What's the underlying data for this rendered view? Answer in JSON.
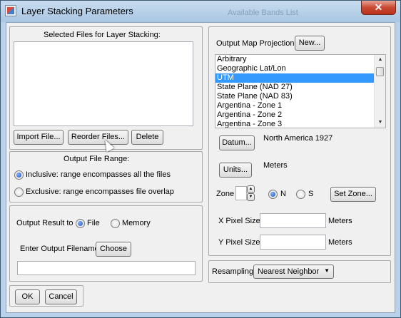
{
  "window": {
    "title": "Layer Stacking Parameters",
    "background_title": "Available Bands List",
    "close_glyph": "✕"
  },
  "files": {
    "heading": "Selected Files for Layer Stacking:",
    "import_label": "Import File...",
    "reorder_label": "Reorder Files...",
    "delete_label": "Delete"
  },
  "range": {
    "heading": "Output File Range:",
    "inclusive_label": "Inclusive: range encompasses all the files",
    "exclusive_label": "Exclusive: range encompasses file overlap",
    "selected": "inclusive"
  },
  "output": {
    "result_to_label": "Output Result to",
    "file_label": "File",
    "memory_label": "Memory",
    "selected": "file",
    "filename_label": "Enter Output Filename",
    "choose_label": "Choose",
    "filename_value": ""
  },
  "footer": {
    "ok_label": "OK",
    "cancel_label": "Cancel"
  },
  "projection": {
    "heading": "Output Map Projection",
    "new_label": "New...",
    "items": [
      "Arbitrary",
      "Geographic Lat/Lon",
      "UTM",
      "State Plane (NAD 27)",
      "State Plane (NAD 83)",
      "Argentina - Zone 1",
      "Argentina - Zone 2",
      "Argentina - Zone 3"
    ],
    "selected_item": "UTM",
    "datum_label": "Datum...",
    "datum_value": "North America 1927",
    "units_label": "Units...",
    "units_value": "Meters",
    "zone_label": "Zone",
    "zone_value": "",
    "n_label": "N",
    "s_label": "S",
    "hemisphere": "N",
    "set_zone_label": "Set Zone...",
    "x_pixel_label": "X Pixel Size",
    "x_pixel_value": "",
    "x_unit": "Meters",
    "y_pixel_label": "Y Pixel Size",
    "y_pixel_value": "",
    "y_unit": "Meters"
  },
  "resampling": {
    "label": "Resampling",
    "value": "Nearest Neighbor"
  }
}
